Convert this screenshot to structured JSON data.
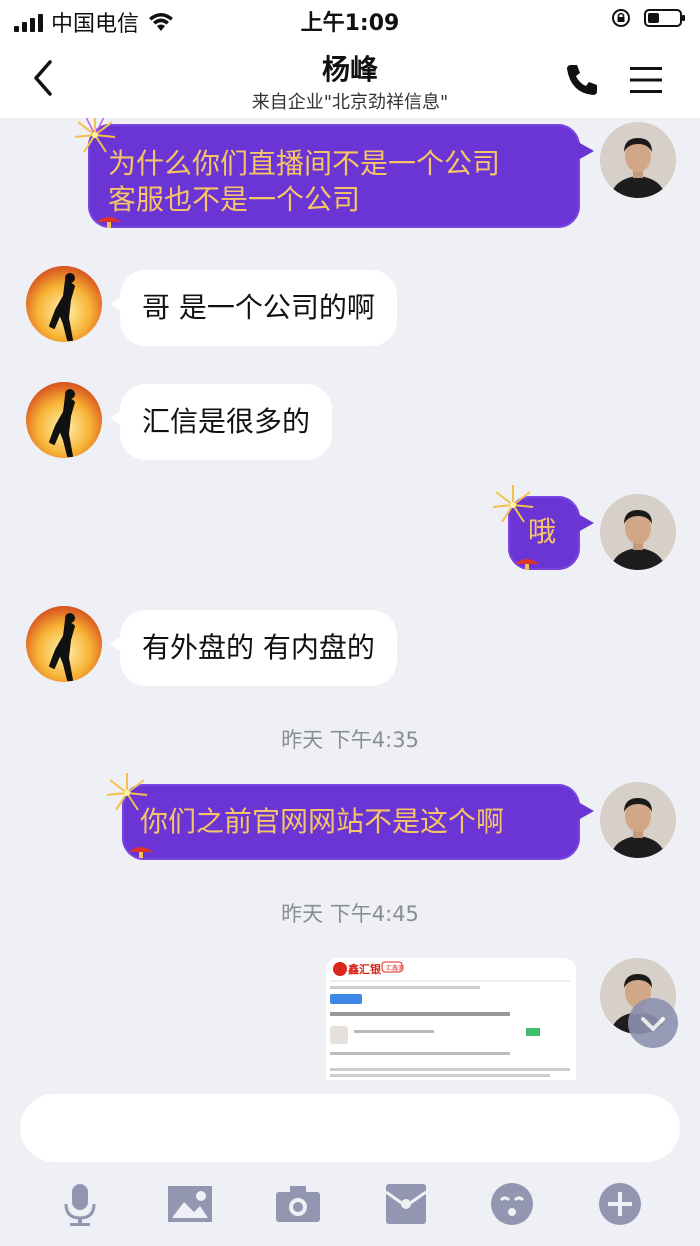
{
  "status_bar": {
    "carrier": "中国电信",
    "time": "上午1:09",
    "battery_level": 0.35
  },
  "header": {
    "title": "杨峰",
    "subtitle": "来自企业\"北京劲祥信息\""
  },
  "messages": [
    {
      "side": "out",
      "lines": [
        "为什么你们直播间不是一个公司",
        "客服也不是一个公司"
      ]
    },
    {
      "side": "in",
      "text": "哥 是一个公司的啊"
    },
    {
      "side": "in",
      "text": "汇信是很多的"
    },
    {
      "side": "out",
      "lines": [
        "哦"
      ]
    },
    {
      "side": "in",
      "text": "有外盘的 有内盘的"
    },
    {
      "type": "timestamp",
      "text": "昨天 下午4:35"
    },
    {
      "side": "out",
      "lines": [
        "你们之前官网网站不是这个啊"
      ]
    },
    {
      "type": "timestamp",
      "text": "昨天 下午4:45"
    },
    {
      "side": "out",
      "type": "image"
    }
  ],
  "image_preview": {
    "logo_text": "鑫汇银",
    "small_label": "汇鑫测"
  },
  "toolbar": {
    "icons": [
      "microphone-icon",
      "image-icon",
      "camera-icon",
      "redpacket-icon",
      "emoji-icon",
      "plus-icon"
    ]
  },
  "colors": {
    "bubble_out": "#6b34d4",
    "bubble_out_text": "#f5c466",
    "bubble_in": "#ffffff",
    "background": "#eef0f6"
  }
}
